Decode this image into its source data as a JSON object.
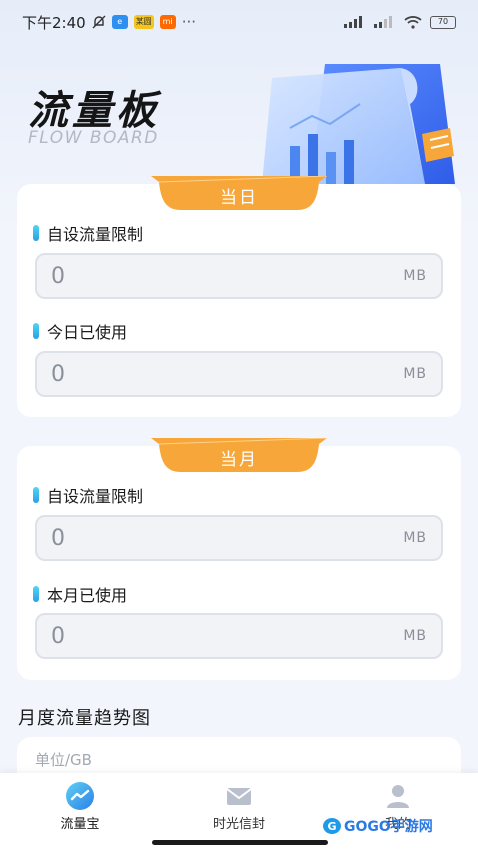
{
  "status_bar": {
    "time": "下午2:40",
    "dots": "···",
    "battery": "70",
    "badge_a": "e",
    "badge_b": "某圆",
    "badge_c": "mi"
  },
  "hero": {
    "title": "流量板",
    "subtitle": "FLOW BOARD"
  },
  "daily_card": {
    "tab_label": "当日",
    "limit": {
      "label": "自设流量限制",
      "value": "0",
      "unit": "MB"
    },
    "used": {
      "label": "今日已使用",
      "value": "0",
      "unit": "MB"
    }
  },
  "monthly_card": {
    "tab_label": "当月",
    "limit": {
      "label": "自设流量限制",
      "value": "0",
      "unit": "MB"
    },
    "used": {
      "label": "本月已使用",
      "value": "0",
      "unit": "MB"
    }
  },
  "trend": {
    "title": "月度流量趋势图",
    "unit_label": "单位/GB"
  },
  "bottom_nav": {
    "items": [
      {
        "label": "流量宝",
        "icon": "trend-icon",
        "active": true
      },
      {
        "label": "时光信封",
        "icon": "envelope-icon",
        "active": false
      },
      {
        "label": "我的",
        "icon": "user-icon",
        "active": false
      }
    ]
  },
  "watermark": {
    "brand": "GOGO手游网",
    "url": "www.gogo.com"
  },
  "colors": {
    "accent_orange": "#f7a63a",
    "accent_blue": "#2a9fe6",
    "active_nav": "#2d8cf0"
  }
}
